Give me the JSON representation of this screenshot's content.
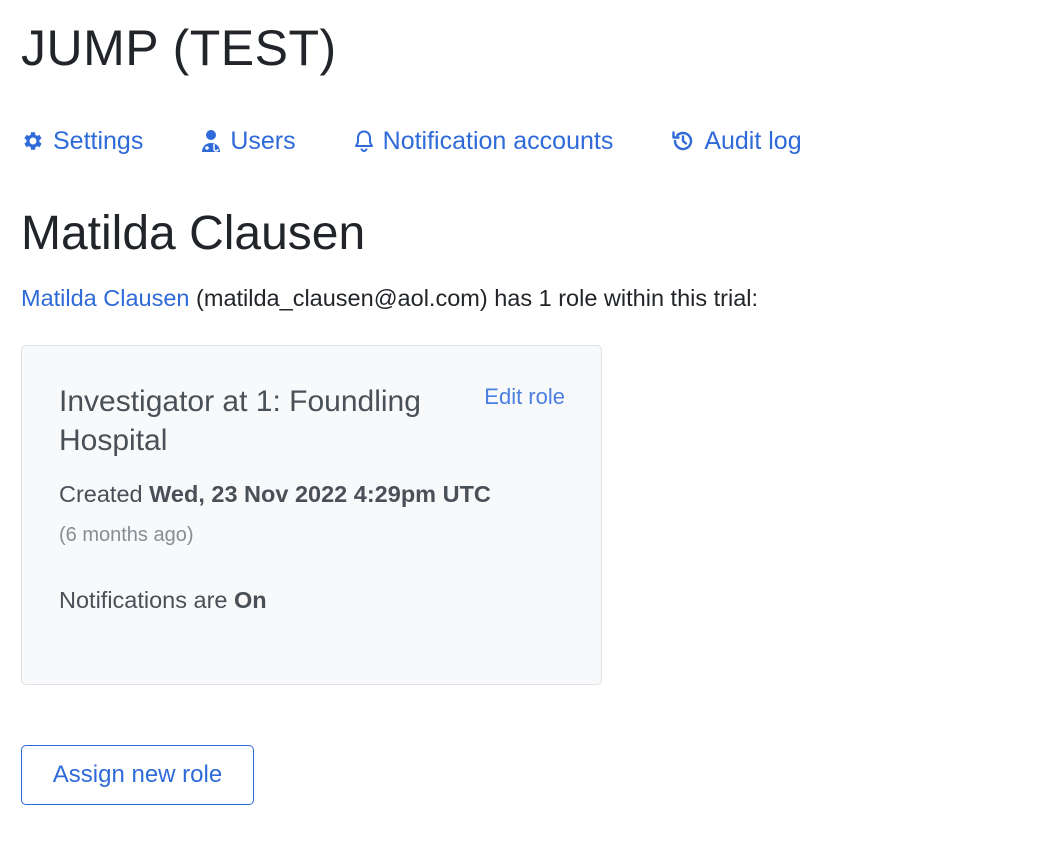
{
  "app": {
    "title": "JUMP (TEST)"
  },
  "nav": {
    "items": [
      {
        "label": "Settings",
        "icon": "gear-icon"
      },
      {
        "label": "Users",
        "icon": "user-doctor-icon"
      },
      {
        "label": "Notification accounts",
        "icon": "bell-icon"
      },
      {
        "label": "Audit log",
        "icon": "history-icon"
      }
    ]
  },
  "user": {
    "name": "Matilda Clausen",
    "link_text": "Matilda Clausen",
    "email_text": "(matilda_clausen@aol.com)",
    "roles_text": "has 1 role within this trial:"
  },
  "role": {
    "title": "Investigator at 1: Foundling Hospital",
    "edit_label": "Edit role",
    "created_prefix": "Created",
    "created_value": "Wed, 23 Nov 2022 4:29pm UTC",
    "created_ago": "(6 months ago)",
    "notifications_prefix": "Notifications are",
    "notifications_value": "On"
  },
  "actions": {
    "assign_label": "Assign new role"
  },
  "colors": {
    "link": "#2f6ad9",
    "text": "#212529",
    "muted": "#868e96",
    "card_bg": "#f8f9fa"
  }
}
